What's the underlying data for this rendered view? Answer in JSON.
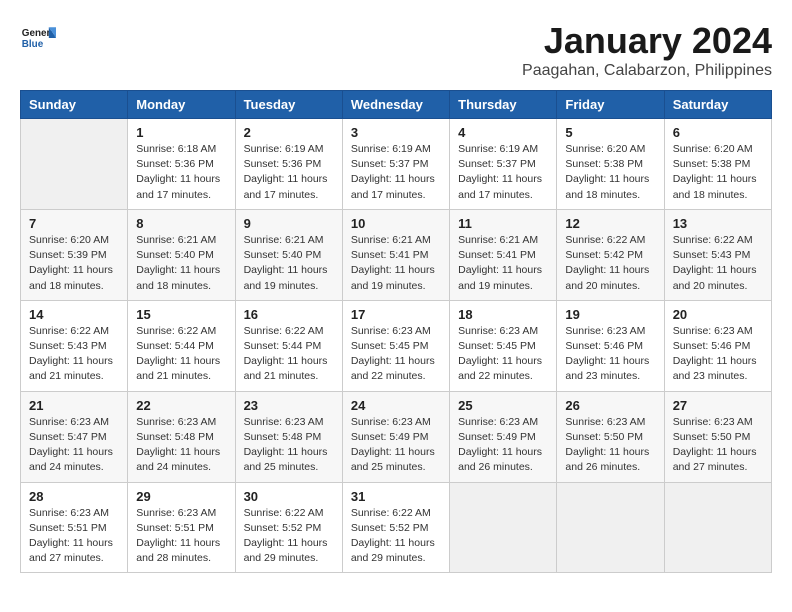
{
  "header": {
    "logo_general": "General",
    "logo_blue": "Blue",
    "title": "January 2024",
    "subtitle": "Paagahan, Calabarzon, Philippines"
  },
  "days_of_week": [
    "Sunday",
    "Monday",
    "Tuesday",
    "Wednesday",
    "Thursday",
    "Friday",
    "Saturday"
  ],
  "weeks": [
    [
      {
        "day": "",
        "sunrise": "",
        "sunset": "",
        "daylight": ""
      },
      {
        "day": "1",
        "sunrise": "Sunrise: 6:18 AM",
        "sunset": "Sunset: 5:36 PM",
        "daylight": "Daylight: 11 hours and 17 minutes."
      },
      {
        "day": "2",
        "sunrise": "Sunrise: 6:19 AM",
        "sunset": "Sunset: 5:36 PM",
        "daylight": "Daylight: 11 hours and 17 minutes."
      },
      {
        "day": "3",
        "sunrise": "Sunrise: 6:19 AM",
        "sunset": "Sunset: 5:37 PM",
        "daylight": "Daylight: 11 hours and 17 minutes."
      },
      {
        "day": "4",
        "sunrise": "Sunrise: 6:19 AM",
        "sunset": "Sunset: 5:37 PM",
        "daylight": "Daylight: 11 hours and 17 minutes."
      },
      {
        "day": "5",
        "sunrise": "Sunrise: 6:20 AM",
        "sunset": "Sunset: 5:38 PM",
        "daylight": "Daylight: 11 hours and 18 minutes."
      },
      {
        "day": "6",
        "sunrise": "Sunrise: 6:20 AM",
        "sunset": "Sunset: 5:38 PM",
        "daylight": "Daylight: 11 hours and 18 minutes."
      }
    ],
    [
      {
        "day": "7",
        "sunrise": "Sunrise: 6:20 AM",
        "sunset": "Sunset: 5:39 PM",
        "daylight": "Daylight: 11 hours and 18 minutes."
      },
      {
        "day": "8",
        "sunrise": "Sunrise: 6:21 AM",
        "sunset": "Sunset: 5:40 PM",
        "daylight": "Daylight: 11 hours and 18 minutes."
      },
      {
        "day": "9",
        "sunrise": "Sunrise: 6:21 AM",
        "sunset": "Sunset: 5:40 PM",
        "daylight": "Daylight: 11 hours and 19 minutes."
      },
      {
        "day": "10",
        "sunrise": "Sunrise: 6:21 AM",
        "sunset": "Sunset: 5:41 PM",
        "daylight": "Daylight: 11 hours and 19 minutes."
      },
      {
        "day": "11",
        "sunrise": "Sunrise: 6:21 AM",
        "sunset": "Sunset: 5:41 PM",
        "daylight": "Daylight: 11 hours and 19 minutes."
      },
      {
        "day": "12",
        "sunrise": "Sunrise: 6:22 AM",
        "sunset": "Sunset: 5:42 PM",
        "daylight": "Daylight: 11 hours and 20 minutes."
      },
      {
        "day": "13",
        "sunrise": "Sunrise: 6:22 AM",
        "sunset": "Sunset: 5:43 PM",
        "daylight": "Daylight: 11 hours and 20 minutes."
      }
    ],
    [
      {
        "day": "14",
        "sunrise": "Sunrise: 6:22 AM",
        "sunset": "Sunset: 5:43 PM",
        "daylight": "Daylight: 11 hours and 21 minutes."
      },
      {
        "day": "15",
        "sunrise": "Sunrise: 6:22 AM",
        "sunset": "Sunset: 5:44 PM",
        "daylight": "Daylight: 11 hours and 21 minutes."
      },
      {
        "day": "16",
        "sunrise": "Sunrise: 6:22 AM",
        "sunset": "Sunset: 5:44 PM",
        "daylight": "Daylight: 11 hours and 21 minutes."
      },
      {
        "day": "17",
        "sunrise": "Sunrise: 6:23 AM",
        "sunset": "Sunset: 5:45 PM",
        "daylight": "Daylight: 11 hours and 22 minutes."
      },
      {
        "day": "18",
        "sunrise": "Sunrise: 6:23 AM",
        "sunset": "Sunset: 5:45 PM",
        "daylight": "Daylight: 11 hours and 22 minutes."
      },
      {
        "day": "19",
        "sunrise": "Sunrise: 6:23 AM",
        "sunset": "Sunset: 5:46 PM",
        "daylight": "Daylight: 11 hours and 23 minutes."
      },
      {
        "day": "20",
        "sunrise": "Sunrise: 6:23 AM",
        "sunset": "Sunset: 5:46 PM",
        "daylight": "Daylight: 11 hours and 23 minutes."
      }
    ],
    [
      {
        "day": "21",
        "sunrise": "Sunrise: 6:23 AM",
        "sunset": "Sunset: 5:47 PM",
        "daylight": "Daylight: 11 hours and 24 minutes."
      },
      {
        "day": "22",
        "sunrise": "Sunrise: 6:23 AM",
        "sunset": "Sunset: 5:48 PM",
        "daylight": "Daylight: 11 hours and 24 minutes."
      },
      {
        "day": "23",
        "sunrise": "Sunrise: 6:23 AM",
        "sunset": "Sunset: 5:48 PM",
        "daylight": "Daylight: 11 hours and 25 minutes."
      },
      {
        "day": "24",
        "sunrise": "Sunrise: 6:23 AM",
        "sunset": "Sunset: 5:49 PM",
        "daylight": "Daylight: 11 hours and 25 minutes."
      },
      {
        "day": "25",
        "sunrise": "Sunrise: 6:23 AM",
        "sunset": "Sunset: 5:49 PM",
        "daylight": "Daylight: 11 hours and 26 minutes."
      },
      {
        "day": "26",
        "sunrise": "Sunrise: 6:23 AM",
        "sunset": "Sunset: 5:50 PM",
        "daylight": "Daylight: 11 hours and 26 minutes."
      },
      {
        "day": "27",
        "sunrise": "Sunrise: 6:23 AM",
        "sunset": "Sunset: 5:50 PM",
        "daylight": "Daylight: 11 hours and 27 minutes."
      }
    ],
    [
      {
        "day": "28",
        "sunrise": "Sunrise: 6:23 AM",
        "sunset": "Sunset: 5:51 PM",
        "daylight": "Daylight: 11 hours and 27 minutes."
      },
      {
        "day": "29",
        "sunrise": "Sunrise: 6:23 AM",
        "sunset": "Sunset: 5:51 PM",
        "daylight": "Daylight: 11 hours and 28 minutes."
      },
      {
        "day": "30",
        "sunrise": "Sunrise: 6:22 AM",
        "sunset": "Sunset: 5:52 PM",
        "daylight": "Daylight: 11 hours and 29 minutes."
      },
      {
        "day": "31",
        "sunrise": "Sunrise: 6:22 AM",
        "sunset": "Sunset: 5:52 PM",
        "daylight": "Daylight: 11 hours and 29 minutes."
      },
      {
        "day": "",
        "sunrise": "",
        "sunset": "",
        "daylight": ""
      },
      {
        "day": "",
        "sunrise": "",
        "sunset": "",
        "daylight": ""
      },
      {
        "day": "",
        "sunrise": "",
        "sunset": "",
        "daylight": ""
      }
    ]
  ]
}
